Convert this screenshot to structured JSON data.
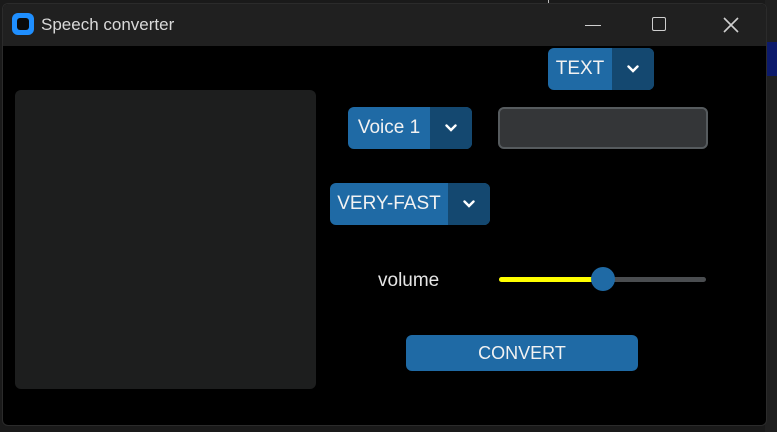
{
  "window": {
    "title": "Speech converter",
    "icons": {
      "app": "app-icon",
      "minimize": "minimize-icon",
      "maximize": "maximize-icon",
      "close": "close-icon"
    }
  },
  "controls": {
    "mode_dropdown": {
      "value": "TEXT",
      "arrow_icon": "chevron-down-icon"
    },
    "voice_dropdown": {
      "value": "Voice 1",
      "arrow_icon": "chevron-down-icon"
    },
    "speed_dropdown": {
      "value": "VERY-FAST",
      "arrow_icon": "chevron-down-icon"
    },
    "text_entry": {
      "value": "",
      "placeholder": ""
    },
    "volume": {
      "label": "volume",
      "level": 0.5
    },
    "convert_button": {
      "label": "CONVERT"
    }
  },
  "colors": {
    "accent": "#1f6aa5",
    "accent_dark": "#144870",
    "slider_progress": "#ffff00",
    "panel": "#1d1e1e",
    "window_bg": "#000000"
  }
}
